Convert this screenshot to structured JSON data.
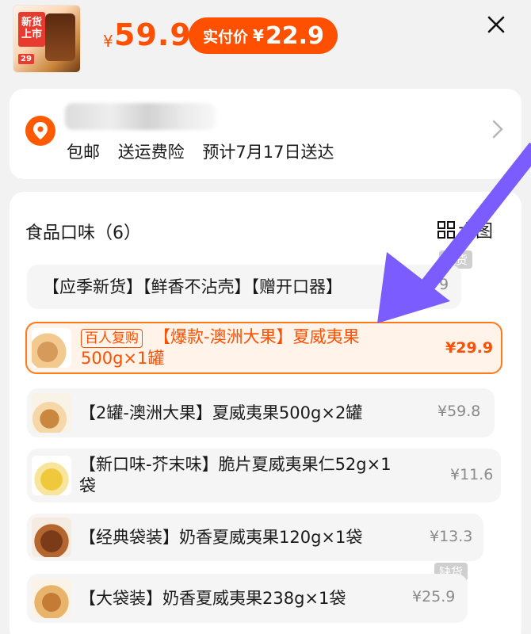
{
  "header": {
    "thumb_tag": "新货上市",
    "thumb_badge": "29",
    "price_symbol": "¥",
    "price": "59.9",
    "pay_label": "实付价",
    "pay_symbol": "¥",
    "pay_price": "22.9"
  },
  "address": {
    "shipping": [
      "包邮",
      "送运费险",
      "预计7月17日送达"
    ]
  },
  "flavor": {
    "title": "食品口味（6）",
    "toggle_label": "大图",
    "out_of_stock": "缺货",
    "options": [
      {
        "label": "【应季新货】【鲜香不沾壳】【赠开口器】",
        "price": "9"
      },
      {
        "tag": "百人复购",
        "label": "【爆款-澳洲大果】夏威夷果500g×1罐",
        "price": "¥29.9"
      },
      {
        "label": "【2罐-澳洲大果】夏威夷果500g×2罐",
        "price": "¥59.8"
      },
      {
        "label": "【新口味-芥末味】脆片夏威夷果仁52g×1袋",
        "price": "¥11.6"
      },
      {
        "label": "【经典袋装】奶香夏威夷果120g×1袋",
        "price": "¥13.3"
      },
      {
        "label": "【大袋装】奶香夏威夷果238g×1袋",
        "price": "¥25.9"
      }
    ]
  },
  "colors": {
    "accent": "#ff5000",
    "arrow": "#7b5cff",
    "selected_bg": "#fff3ea"
  },
  "icons": {
    "close": "close-icon",
    "pin": "location-pin-icon",
    "chevron": "chevron-right-icon",
    "grid": "grid-icon"
  }
}
